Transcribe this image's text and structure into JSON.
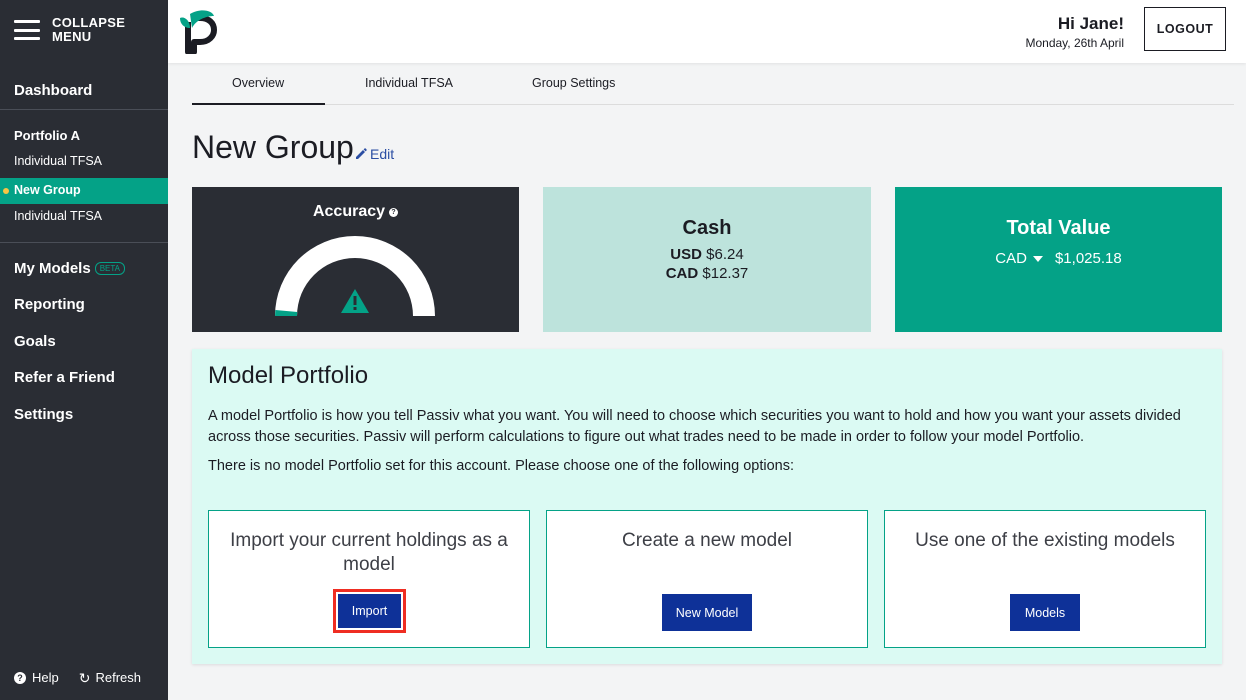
{
  "sidebar": {
    "collapse_label": "COLLAPSE MENU",
    "dashboard": "Dashboard",
    "portfolio_heading": "Portfolio A",
    "items": [
      "Individual TFSA",
      "New Group",
      "Individual TFSA"
    ],
    "my_models": "My Models",
    "beta": "BETA",
    "reporting": "Reporting",
    "goals": "Goals",
    "refer": "Refer a Friend",
    "settings": "Settings",
    "help": "Help",
    "refresh": "Refresh"
  },
  "header": {
    "greeting": "Hi Jane!",
    "date": "Monday, 26th April",
    "logout": "LOGOUT"
  },
  "tabs": [
    "Overview",
    "Individual TFSA",
    "Group Settings"
  ],
  "group": {
    "title": "New Group",
    "edit": "Edit"
  },
  "cards": {
    "accuracy_title": "Accuracy",
    "cash_title": "Cash",
    "cash_usd_label": "USD",
    "cash_usd_value": "$6.24",
    "cash_cad_label": "CAD",
    "cash_cad_value": "$12.37",
    "total_title": "Total Value",
    "total_currency": "CAD",
    "total_value": "$1,025.18"
  },
  "model": {
    "title": "Model Portfolio",
    "description": "A model Portfolio is how you tell Passiv what you want. You will need to choose which securities you want to hold and how you want your assets divided across those securities. Passiv will perform calculations to figure out what trades need to be made in order to follow your model Portfolio.",
    "note": "There is no model Portfolio set for this account. Please choose one of the following options:",
    "options": [
      {
        "text": "Import your current holdings as a model",
        "button": "Import"
      },
      {
        "text": "Create a new model",
        "button": "New Model"
      },
      {
        "text": "Use one of the existing models",
        "button": "Models"
      }
    ]
  },
  "colors": {
    "sidebar_bg": "#2a2d34",
    "accent_green": "#04a287",
    "button_blue": "#0e3198",
    "highlight_red": "#ef2d22"
  }
}
